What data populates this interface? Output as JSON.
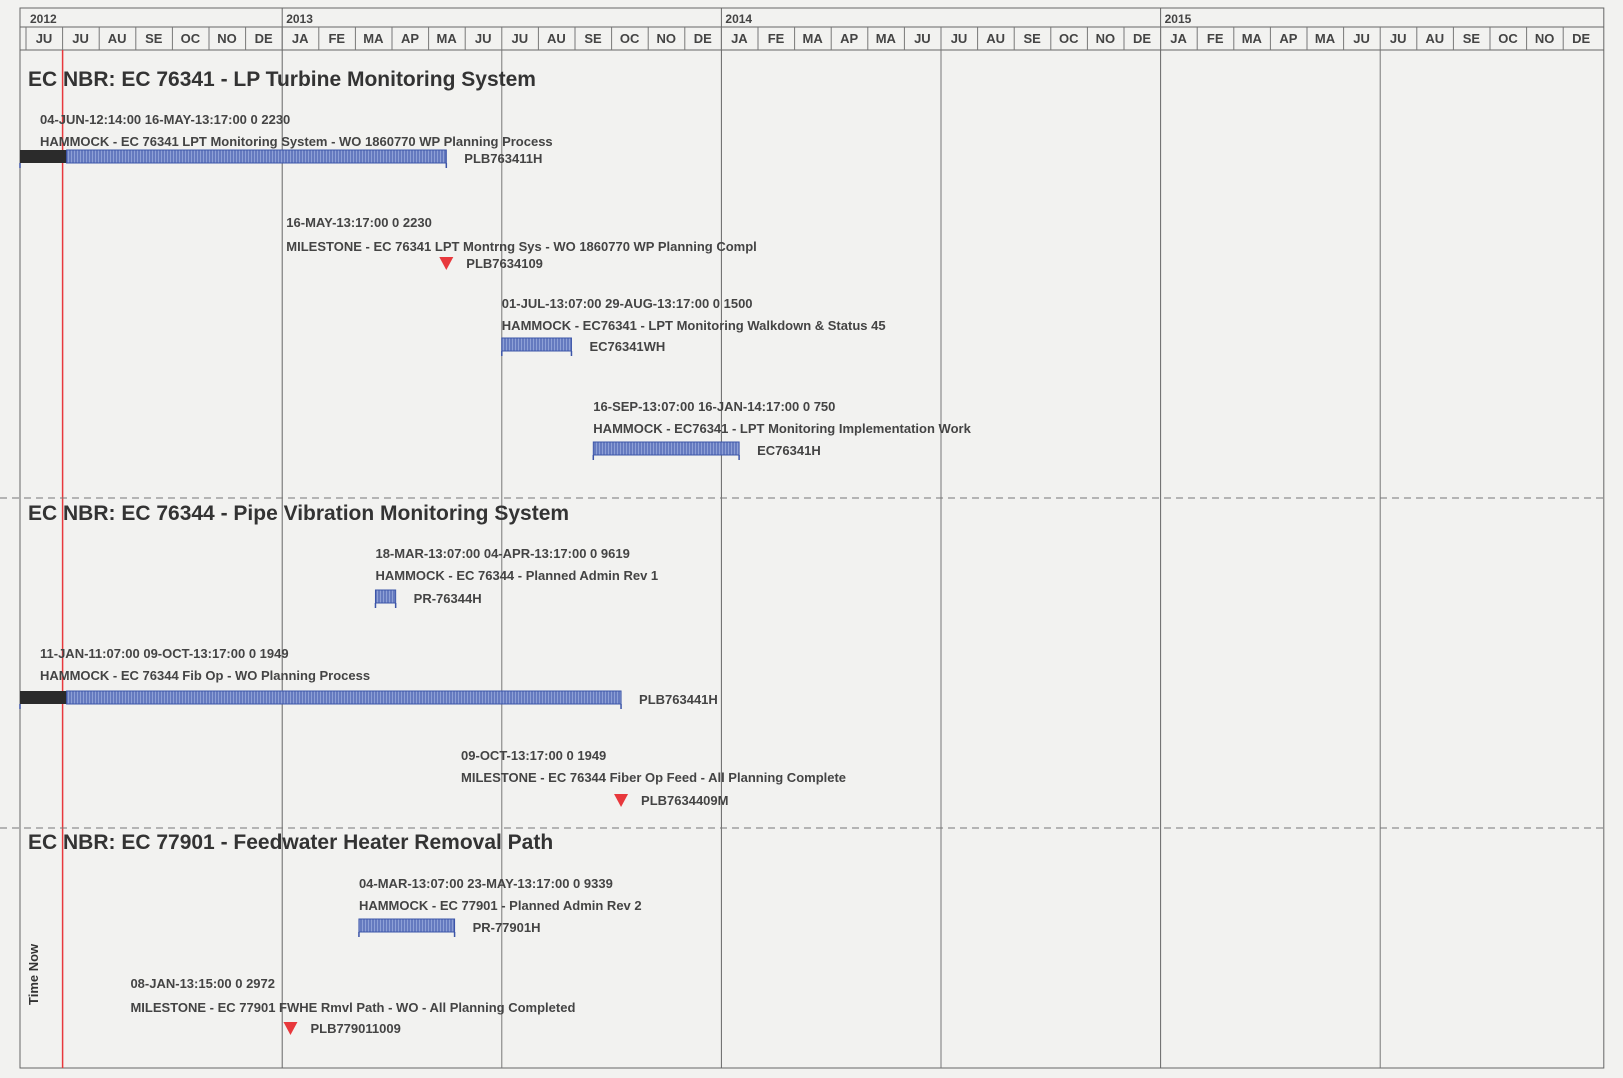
{
  "chart_data": {
    "type": "gantt",
    "time_now_label": "Time Now",
    "years": [
      {
        "label": "2012",
        "start": "2012-06"
      },
      {
        "label": "2013",
        "start": "2013-01"
      },
      {
        "label": "2014",
        "start": "2014-01"
      },
      {
        "label": "2015",
        "start": "2015-01"
      }
    ],
    "month_labels": [
      "JU",
      "JU",
      "AU",
      "SE",
      "OC",
      "NO",
      "DE",
      "JA",
      "FE",
      "MA",
      "AP",
      "MA",
      "JU",
      "JU",
      "AU",
      "SE",
      "OC",
      "NO",
      "DE",
      "JA",
      "FE",
      "MA",
      "AP",
      "MA",
      "JU",
      "JU",
      "AU",
      "SE",
      "OC",
      "NO",
      "DE",
      "JA",
      "FE",
      "MA",
      "AP",
      "MA",
      "JU",
      "JU",
      "AU",
      "SE",
      "OC",
      "NO",
      "DE"
    ],
    "sections": [
      {
        "title": "EC NBR: EC 76341 - LP Turbine Monitoring System",
        "activities": [
          {
            "type": "bar",
            "dates": "04-JUN-12:14:00 16-MAY-13:17:00 0 2230",
            "desc": "HAMMOCK - EC 76341 LPT Monitoring System - WO 1860770  WP Planning Process",
            "id": "PLB763411H",
            "start": "2012-06-04",
            "end": "2013-05-16",
            "clipped_start": true
          },
          {
            "type": "milestone",
            "dates": "16-MAY-13:17:00 0 2230",
            "desc": "MILESTONE - EC 76341 LPT Montrng Sys - WO 1860770  WP Planning Compl",
            "id": "PLB7634109",
            "start": "2013-05-16"
          },
          {
            "type": "bar",
            "dates": "01-JUL-13:07:00 29-AUG-13:17:00 0 1500",
            "desc": "HAMMOCK - EC76341 - LPT Monitoring Walkdown & Status 45",
            "id": "EC76341WH",
            "start": "2013-07-01",
            "end": "2013-08-29"
          },
          {
            "type": "bar",
            "dates": "16-SEP-13:07:00 16-JAN-14:17:00 0 750",
            "desc": "HAMMOCK - EC76341 - LPT Monitoring Implementation Work",
            "id": "EC76341H",
            "start": "2013-09-16",
            "end": "2014-01-16"
          }
        ]
      },
      {
        "title": "EC NBR: EC 76344 - Pipe Vibration Monitoring System",
        "activities": [
          {
            "type": "bar",
            "dates": "18-MAR-13:07:00 04-APR-13:17:00 0 9619",
            "desc": "HAMMOCK - EC 76344 - Planned Admin Rev 1",
            "id": "PR-76344H",
            "start": "2013-03-18",
            "end": "2013-04-04"
          },
          {
            "type": "bar",
            "dates": "11-JAN-11:07:00 09-OCT-13:17:00 0 1949",
            "desc": "HAMMOCK - EC 76344 Fib Op - WO Planning Process",
            "id": "PLB763441H",
            "start": "2011-01-11",
            "end": "2013-10-09",
            "clipped_start": true
          },
          {
            "type": "milestone",
            "dates": "09-OCT-13:17:00 0 1949",
            "desc": "MILESTONE - EC 76344 Fiber Op Feed - All Planning Complete",
            "id": "PLB7634409M",
            "start": "2013-10-09"
          }
        ]
      },
      {
        "title": "EC NBR: EC 77901 - Feedwater Heater Removal Path",
        "activities": [
          {
            "type": "bar",
            "dates": "04-MAR-13:07:00 23-MAY-13:17:00 0 9339",
            "desc": "HAMMOCK - EC 77901 - Planned Admin Rev 2",
            "id": "PR-77901H",
            "start": "2013-03-04",
            "end": "2013-05-23"
          },
          {
            "type": "milestone",
            "dates": "08-JAN-13:15:00 0 2972",
            "desc": "MILESTONE - EC 77901 FWHE Rmvl Path - WO - All Planning Completed",
            "id": "PLB779011009",
            "start": "2013-01-08"
          }
        ]
      }
    ],
    "colors": {
      "bar_fill": "#6f86c8",
      "bar_hatch": "#3c55a8",
      "milestone": "#e8383c",
      "time_now_line": "#e8383c",
      "grid": "#666666",
      "section_divider": "#777777",
      "clipped_bar": "#2b2b2b"
    }
  }
}
